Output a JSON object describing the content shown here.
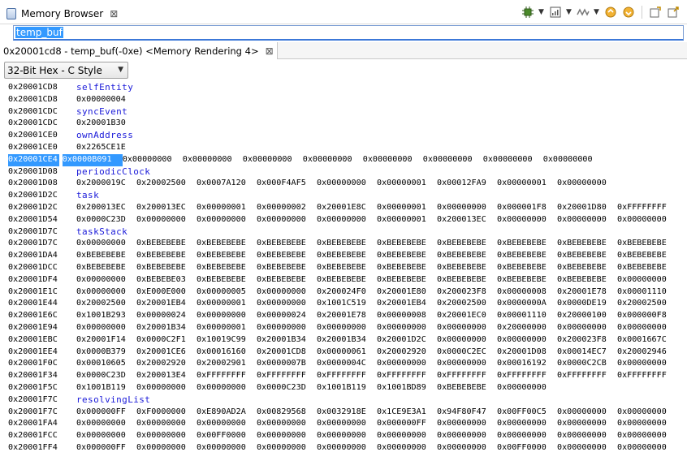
{
  "view": {
    "title": "Memory Browser",
    "close_glyph": "⊠"
  },
  "toolbar": {
    "buttons": [
      "chip-icon",
      "memory-icon",
      "wave-icon",
      "import-icon",
      "export-icon",
      "new-tab-icon",
      "new-window-icon"
    ]
  },
  "expression": {
    "value": "temp_buf"
  },
  "rendering_tab": {
    "label": "0x20001cd8 - temp_buf(-0xe) <Memory Rendering 4>",
    "close_glyph": "⊠"
  },
  "format": {
    "selected": "32-Bit Hex - C Style"
  },
  "colors": {
    "label_blue": "#1a1ad9",
    "selection": "#3399ff"
  },
  "rows": [
    {
      "addr": "0x20001CD8",
      "label": "selfEntity"
    },
    {
      "addr": "0x20001CD8",
      "values": [
        "0x00000004"
      ]
    },
    {
      "addr": "0x20001CDC",
      "label": "syncEvent"
    },
    {
      "addr": "0x20001CDC",
      "values": [
        "0x20001B30"
      ]
    },
    {
      "addr": "0x20001CE0",
      "label": "ownAddress"
    },
    {
      "addr": "0x20001CE0",
      "values": [
        "0x2265CE1E"
      ]
    },
    {
      "addr": "0x20001CE4",
      "highlight": true,
      "values": [
        "0x0000B091",
        "0x00000000",
        "0x00000000",
        "0x00000000",
        "0x00000000",
        "0x00000000",
        "0x00000000",
        "0x00000000",
        "0x00000000"
      ]
    },
    {
      "addr": "0x20001D08",
      "label": "periodicClock"
    },
    {
      "addr": "0x20001D08",
      "values": [
        "0x2000019C",
        "0x20002500",
        "0x0007A120",
        "0x000F4AF5",
        "0x00000000",
        "0x00000001",
        "0x00012FA9",
        "0x00000001",
        "0x00000000"
      ]
    },
    {
      "addr": "0x20001D2C",
      "label": "task"
    },
    {
      "addr": "0x20001D2C",
      "values": [
        "0x200013EC",
        "0x200013EC",
        "0x00000001",
        "0x00000002",
        "0x20001E8C",
        "0x00000001",
        "0x00000000",
        "0x000001F8",
        "0x20001D80",
        "0xFFFFFFFF"
      ]
    },
    {
      "addr": "0x20001D54",
      "values": [
        "0x0000C23D",
        "0x00000000",
        "0x00000000",
        "0x00000000",
        "0x00000000",
        "0x00000001",
        "0x200013EC",
        "0x00000000",
        "0x00000000",
        "0x00000000"
      ]
    },
    {
      "addr": "0x20001D7C",
      "label": "taskStack"
    },
    {
      "addr": "0x20001D7C",
      "values": [
        "0x00000000",
        "0xBEBEBEBE",
        "0xBEBEBEBE",
        "0xBEBEBEBE",
        "0xBEBEBEBE",
        "0xBEBEBEBE",
        "0xBEBEBEBE",
        "0xBEBEBEBE",
        "0xBEBEBEBE",
        "0xBEBEBEBE"
      ]
    },
    {
      "addr": "0x20001DA4",
      "values": [
        "0xBEBEBEBE",
        "0xBEBEBEBE",
        "0xBEBEBEBE",
        "0xBEBEBEBE",
        "0xBEBEBEBE",
        "0xBEBEBEBE",
        "0xBEBEBEBE",
        "0xBEBEBEBE",
        "0xBEBEBEBE",
        "0xBEBEBEBE"
      ]
    },
    {
      "addr": "0x20001DCC",
      "values": [
        "0xBEBEBEBE",
        "0xBEBEBEBE",
        "0xBEBEBEBE",
        "0xBEBEBEBE",
        "0xBEBEBEBE",
        "0xBEBEBEBE",
        "0xBEBEBEBE",
        "0xBEBEBEBE",
        "0xBEBEBEBE",
        "0xBEBEBEBE"
      ]
    },
    {
      "addr": "0x20001DF4",
      "values": [
        "0x00000000",
        "0xBEBEBE03",
        "0xBEBEBEBE",
        "0xBEBEBEBE",
        "0xBEBEBEBE",
        "0xBEBEBEBE",
        "0xBEBEBEBE",
        "0xBEBEBEBE",
        "0xBEBEBEBE",
        "0x00000000"
      ]
    },
    {
      "addr": "0x20001E1C",
      "values": [
        "0x00000000",
        "0xE000E000",
        "0x00000005",
        "0x00000000",
        "0x200024F0",
        "0x20001E80",
        "0x200023F8",
        "0x00000008",
        "0x20001E78",
        "0x00001110"
      ]
    },
    {
      "addr": "0x20001E44",
      "values": [
        "0x20002500",
        "0x20001EB4",
        "0x00000001",
        "0x00000000",
        "0x1001C519",
        "0x20001EB4",
        "0x20002500",
        "0x0000000A",
        "0x0000DE19",
        "0x20002500"
      ]
    },
    {
      "addr": "0x20001E6C",
      "values": [
        "0x1001B293",
        "0x00000024",
        "0x00000000",
        "0x00000024",
        "0x20001E78",
        "0x00000008",
        "0x20001EC0",
        "0x00001110",
        "0x20000100",
        "0x000000F8"
      ]
    },
    {
      "addr": "0x20001E94",
      "values": [
        "0x00000000",
        "0x20001B34",
        "0x00000001",
        "0x00000000",
        "0x00000000",
        "0x00000000",
        "0x00000000",
        "0x20000000",
        "0x00000000",
        "0x00000000"
      ]
    },
    {
      "addr": "0x20001EBC",
      "values": [
        "0x20001F14",
        "0x0000C2F1",
        "0x10019C99",
        "0x20001B34",
        "0x20001B34",
        "0x20001D2C",
        "0x00000000",
        "0x00000000",
        "0x200023F8",
        "0x0001667C"
      ]
    },
    {
      "addr": "0x20001EE4",
      "values": [
        "0x0000B379",
        "0x20001CE6",
        "0x00016160",
        "0x20001CD8",
        "0x00000061",
        "0x20002920",
        "0x0000C2EC",
        "0x20001D08",
        "0x00014EC7",
        "0x20002946"
      ]
    },
    {
      "addr": "0x20001F0C",
      "values": [
        "0x00010605",
        "0x20002920",
        "0x20002901",
        "0x0000007B",
        "0x0000004C",
        "0x00000000",
        "0x00000000",
        "0x00016192",
        "0x0000C2CB",
        "0x00000000"
      ]
    },
    {
      "addr": "0x20001F34",
      "values": [
        "0x0000C23D",
        "0x200013E4",
        "0xFFFFFFFF",
        "0xFFFFFFFF",
        "0xFFFFFFFF",
        "0xFFFFFFFF",
        "0xFFFFFFFF",
        "0xFFFFFFFF",
        "0xFFFFFFFF",
        "0xFFFFFFFF"
      ]
    },
    {
      "addr": "0x20001F5C",
      "values": [
        "0x1001B119",
        "0x00000000",
        "0x00000000",
        "0x0000C23D",
        "0x1001B119",
        "0x1001BD89",
        "0xBEBEBEBE",
        "0x00000000"
      ]
    },
    {
      "addr": "0x20001F7C",
      "label": "resolvingList"
    },
    {
      "addr": "0x20001F7C",
      "values": [
        "0x000000FF",
        "0xF0000000",
        "0xE890AD2A",
        "0x00829568",
        "0x0032918E",
        "0x1CE9E3A1",
        "0x94F80F47",
        "0x00FF00C5",
        "0x00000000",
        "0x00000000"
      ]
    },
    {
      "addr": "0x20001FA4",
      "values": [
        "0x00000000",
        "0x00000000",
        "0x00000000",
        "0x00000000",
        "0x00000000",
        "0x000000FF",
        "0x00000000",
        "0x00000000",
        "0x00000000",
        "0x00000000"
      ]
    },
    {
      "addr": "0x20001FCC",
      "values": [
        "0x00000000",
        "0x00000000",
        "0x00FF0000",
        "0x00000000",
        "0x00000000",
        "0x00000000",
        "0x00000000",
        "0x00000000",
        "0x00000000",
        "0x00000000"
      ]
    },
    {
      "addr": "0x20001FF4",
      "values": [
        "0x000000FF",
        "0x00000000",
        "0x00000000",
        "0x00000000",
        "0x00000000",
        "0x00000000",
        "0x00000000",
        "0x00FF0000",
        "0x00000000",
        "0x00000000"
      ]
    }
  ]
}
